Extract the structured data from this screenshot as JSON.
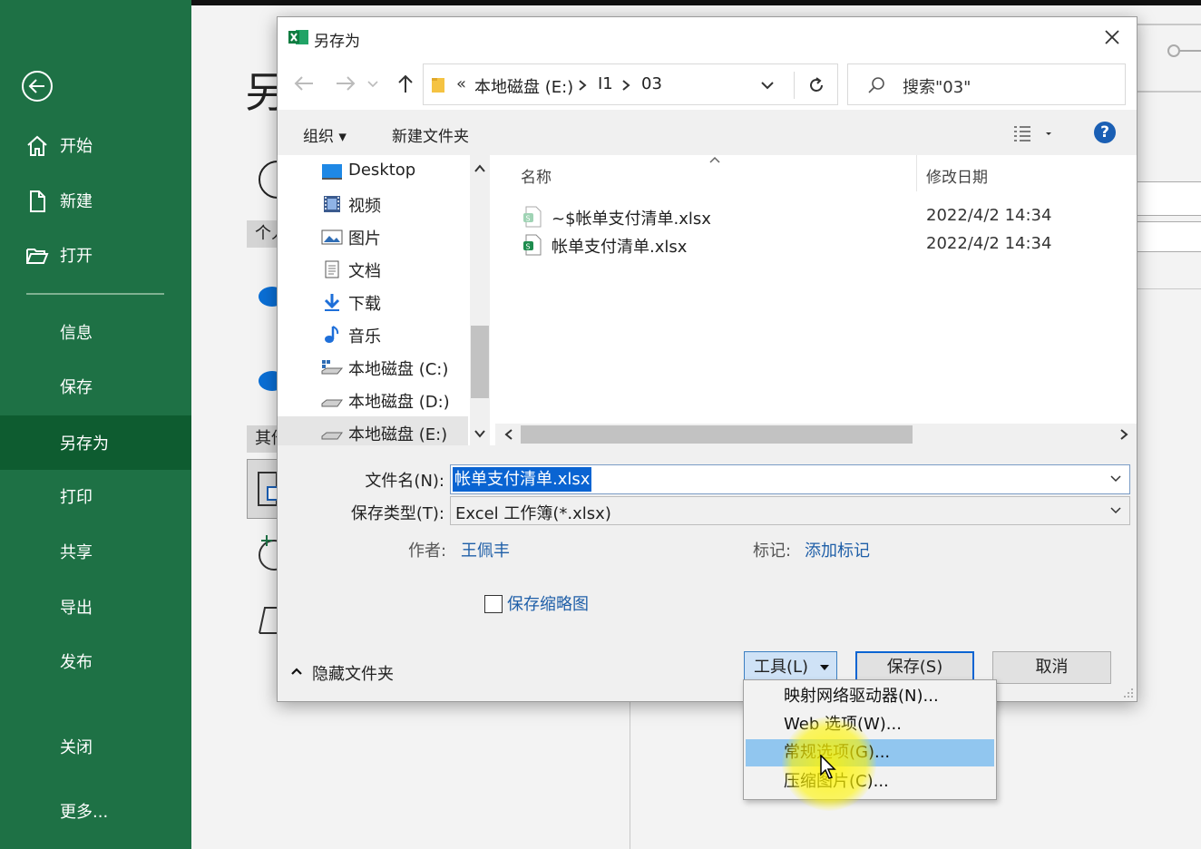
{
  "backstage": {
    "title_fragment": "另",
    "section_fragment_1": "个人",
    "section_fragment_2": "其他",
    "nav": [
      {
        "label": "开始",
        "icon": "home-icon"
      },
      {
        "label": "新建",
        "icon": "new-document-icon"
      },
      {
        "label": "打开",
        "icon": "open-folder-icon"
      },
      {
        "label": "信息"
      },
      {
        "label": "保存"
      },
      {
        "label": "另存为",
        "selected": true
      },
      {
        "label": "打印"
      },
      {
        "label": "共享"
      },
      {
        "label": "导出"
      },
      {
        "label": "发布"
      },
      {
        "label": "关闭"
      },
      {
        "label": "更多..."
      }
    ],
    "colors": {
      "sidebar": "#1e7145",
      "sidebar_selected": "#0e5c30"
    }
  },
  "dialog": {
    "title": "另存为",
    "address": {
      "prefix": "«",
      "segments": [
        "本地磁盘 (E:)",
        "I1",
        "03"
      ]
    },
    "search_placeholder": "搜索\"03\"",
    "toolbar": {
      "organize": "组织 ▾",
      "new_folder": "新建文件夹",
      "help": "?"
    },
    "nav_tree": [
      {
        "label": "Desktop",
        "icon": "desktop-icon"
      },
      {
        "label": "视频",
        "icon": "video-icon"
      },
      {
        "label": "图片",
        "icon": "pictures-icon"
      },
      {
        "label": "文档",
        "icon": "documents-icon"
      },
      {
        "label": "下载",
        "icon": "download-icon"
      },
      {
        "label": "音乐",
        "icon": "music-icon"
      },
      {
        "label": "本地磁盘 (C:)",
        "icon": "drive-icon"
      },
      {
        "label": "本地磁盘 (D:)",
        "icon": "drive-icon"
      },
      {
        "label": "本地磁盘 (E:)",
        "icon": "drive-icon",
        "selected": true
      }
    ],
    "columns": {
      "name": "名称",
      "modified": "修改日期"
    },
    "files": [
      {
        "name": "~$帐单支付清单.xlsx",
        "modified": "2022/4/2 14:34",
        "icon": "excel-temp-file-icon"
      },
      {
        "name": "帐单支付清单.xlsx",
        "modified": "2022/4/2 14:34",
        "icon": "excel-file-icon"
      }
    ],
    "form": {
      "filename_label": "文件名(N):",
      "filename_value": "帐单支付清单.xlsx",
      "type_label": "保存类型(T):",
      "type_value": "Excel 工作簿(*.xlsx)",
      "author_label": "作者:",
      "author_value": "王佩丰",
      "tags_label": "标记:",
      "tags_value": "添加标记",
      "thumbnail_label": "保存缩略图",
      "thumbnail_checked": false
    },
    "footer": {
      "hide_folders": "隐藏文件夹",
      "tools": "工具(L)",
      "save": "保存(S)",
      "cancel": "取消"
    },
    "tools_menu": [
      {
        "label": "映射网络驱动器(N)..."
      },
      {
        "label": "Web 选项(W)..."
      },
      {
        "label": "常规选项(G)...",
        "highlighted": true
      },
      {
        "label": "压缩图片(C)..."
      }
    ]
  }
}
